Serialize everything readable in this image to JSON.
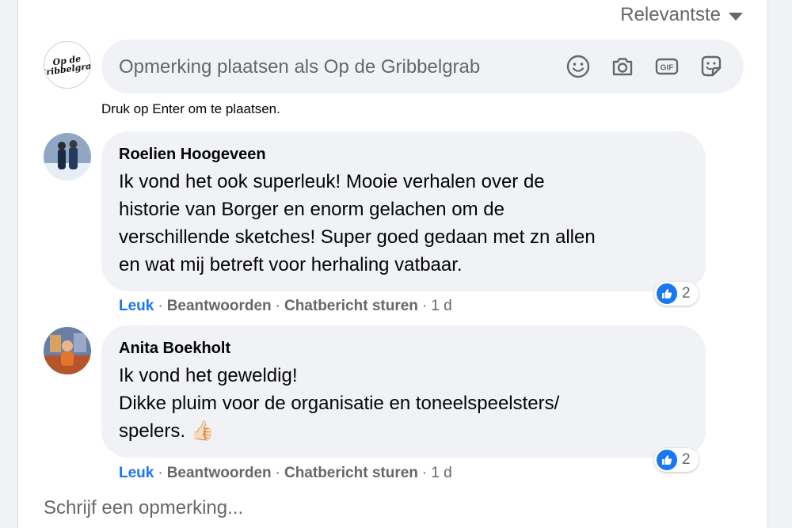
{
  "sort": {
    "label": "Relevantste"
  },
  "composer": {
    "placeholder": "Opmerking plaatsen als Op de Gribbelgrab",
    "hint": "Druk op Enter om te plaatsen.",
    "page_avatar_text": "Op de Gribbelgrab",
    "icons": [
      "emoji-icon",
      "camera-icon",
      "gif-icon",
      "sticker-icon"
    ]
  },
  "comments": [
    {
      "author": "Roelien Hoogeveen",
      "lines": [
        "Ik vond het ook superleuk! Mooie verhalen over de",
        "historie van Borger en enorm gelachen om de",
        "verschillende sketches! Super goed gedaan met zn allen",
        "en wat mij betreft voor herhaling vatbaar."
      ],
      "reaction_count": "2",
      "actions": {
        "like": "Leuk",
        "reply": "Beantwoorden",
        "message": "Chatbericht sturen",
        "time": "1 d"
      }
    },
    {
      "author": "Anita Boekholt",
      "lines": [
        "Ik vond het geweldig!",
        "Dikke pluim voor de organisatie en toneelspeelsters/",
        "spelers. 👍🏻"
      ],
      "reaction_count": "2",
      "actions": {
        "like": "Leuk",
        "reply": "Beantwoorden",
        "message": "Chatbericht sturen",
        "time": "1 d"
      }
    }
  ],
  "write_comment": {
    "placeholder": "Schrijf een opmerking..."
  },
  "colors": {
    "accent": "#1877f2",
    "bubble": "#f0f2f5",
    "secondary_text": "#65676b"
  }
}
